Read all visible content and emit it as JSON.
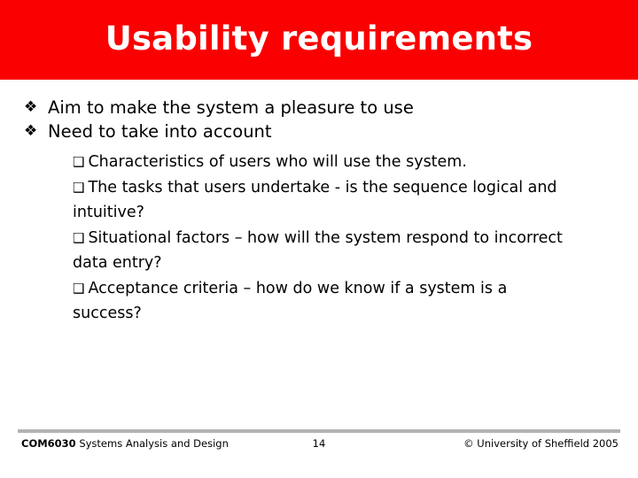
{
  "slide": {
    "title": "Usability requirements",
    "title_bg_color": "#fb0000",
    "title_text_color": "#ffffff",
    "background_color": "#ffffff",
    "body_text_color": "#000000"
  },
  "bullets": {
    "level1_marker": "❖",
    "level2_marker": "❑",
    "items": [
      {
        "text": "Aim to make the system a pleasure to use"
      },
      {
        "text": "Need to take into account"
      }
    ],
    "sub_items": [
      {
        "text": "Characteristics of users who will use the system."
      },
      {
        "text": "The tasks that users undertake - is the sequence logical and intuitive?"
      },
      {
        "text": "Situational factors – how will the system respond to incorrect data entry?"
      },
      {
        "text": "Acceptance criteria – how do we know if a system is a success?"
      }
    ]
  },
  "footer": {
    "course_code": "COM6030",
    "course_title": " Systems Analysis and Design",
    "page_number": "14",
    "copyright": "© University of Sheffield 2005",
    "rule_color": "#b2b2b2"
  }
}
